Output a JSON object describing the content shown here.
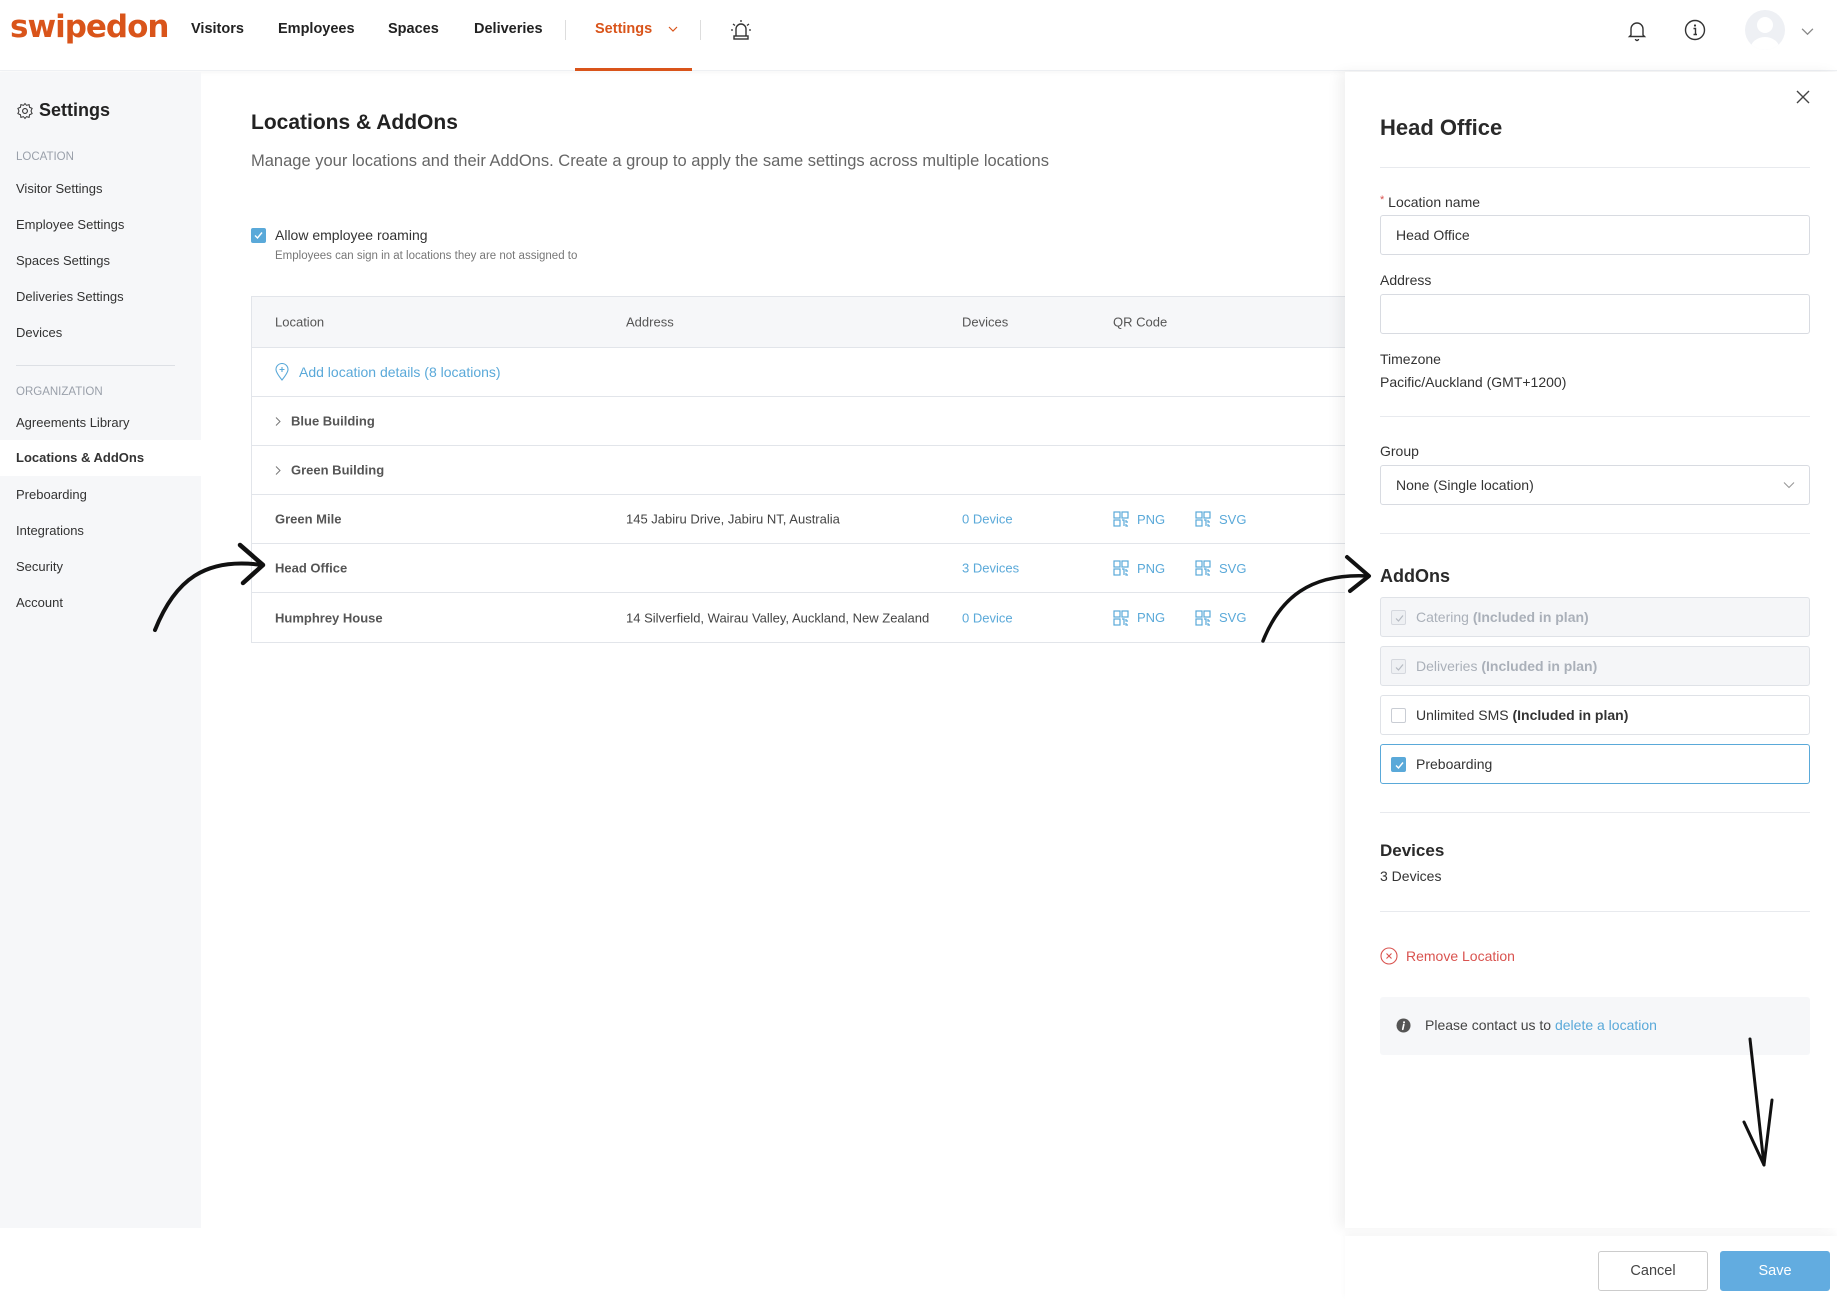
{
  "brand": {
    "logo_text": "swipedon",
    "accent": "#d9541a",
    "link_color": "#5aa9d9",
    "danger_color": "#d9534f"
  },
  "topnav": {
    "items": [
      "Visitors",
      "Employees",
      "Spaces",
      "Deliveries"
    ],
    "active": "Settings",
    "icons": [
      "emergency-alarm-icon",
      "bell-icon",
      "info-icon",
      "avatar",
      "chevron-down-icon"
    ]
  },
  "sidebar": {
    "title": "Settings",
    "location_heading": "LOCATION",
    "location_items": [
      "Visitor Settings",
      "Employee Settings",
      "Spaces Settings",
      "Deliveries Settings",
      "Devices"
    ],
    "organization_heading": "ORGANIZATION",
    "organization_items": [
      "Agreements Library",
      "Locations & AddOns",
      "Preboarding",
      "Integrations",
      "Security",
      "Account"
    ],
    "active_item": "Locations & AddOns"
  },
  "main": {
    "title": "Locations & AddOns",
    "subtitle": "Manage your locations and their AddOns. Create a group to apply the same settings across multiple locations",
    "roaming": {
      "checked": true,
      "label": "Allow employee roaming",
      "help": "Employees can sign in at locations they are not assigned to"
    },
    "table": {
      "headers": {
        "location": "Location",
        "address": "Address",
        "devices": "Devices",
        "qr": "QR Code"
      },
      "add_link": "Add location details (8 locations)",
      "groups": [
        "Blue Building",
        "Green Building"
      ],
      "rows": [
        {
          "name": "Green Mile",
          "address": "145 Jabiru Drive, Jabiru NT, Australia",
          "devices": "0 Device",
          "png": "PNG",
          "svg": "SVG"
        },
        {
          "name": "Head Office",
          "address": "",
          "devices": "3 Devices",
          "png": "PNG",
          "svg": "SVG"
        },
        {
          "name": "Humphrey House",
          "address": "14 Silverfield, Wairau Valley, Auckland, New Zealand",
          "devices": "0 Device",
          "png": "PNG",
          "svg": "SVG"
        }
      ]
    }
  },
  "panel": {
    "title": "Head Office",
    "location_name_label": "Location name",
    "required_mark": "*",
    "location_name_value": "Head Office",
    "address_label": "Address",
    "address_value": "",
    "timezone_label": "Timezone",
    "timezone_value": "Pacific/Auckland (GMT+1200)",
    "group_label": "Group",
    "group_value": "None (Single location)",
    "addons_heading": "AddOns",
    "addons": [
      {
        "name": "Catering",
        "note": "(Included in plan)",
        "checked": true,
        "disabled": true
      },
      {
        "name": "Deliveries",
        "note": "(Included in plan)",
        "checked": true,
        "disabled": true
      },
      {
        "name": "Unlimited SMS",
        "note": "(Included in plan)",
        "checked": false,
        "disabled": false
      },
      {
        "name": "Preboarding",
        "note": "",
        "checked": true,
        "disabled": false
      }
    ],
    "devices_heading": "Devices",
    "devices_link": "3 Devices",
    "remove_label": "Remove Location",
    "info_text": "Please contact us to ",
    "info_link": "delete a location",
    "cancel_label": "Cancel",
    "save_label": "Save"
  }
}
